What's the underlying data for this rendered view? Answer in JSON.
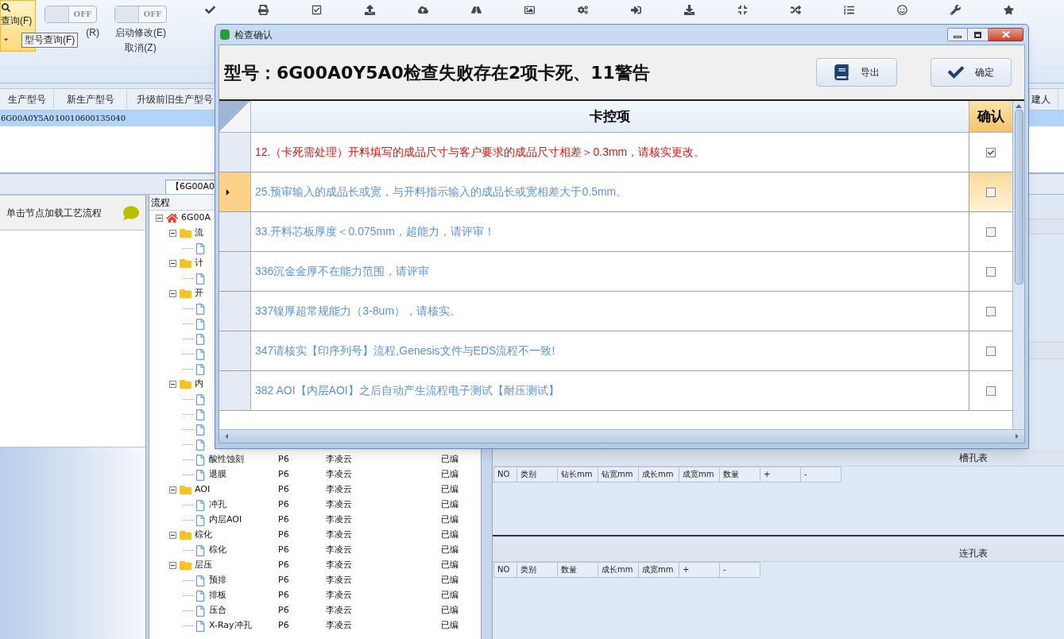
{
  "toolbar": {
    "query_button": {
      "label": "查询(F)"
    },
    "toggles": [
      {
        "label": "(R)",
        "state_text": "OFF",
        "on": false
      },
      {
        "label": "启动修改(E)",
        "sublabel": "取消(Z)",
        "state_text": "OFF",
        "on": false
      }
    ],
    "tooltip": "型号查询(F)"
  },
  "main_table": {
    "columns": [
      "生产型号",
      "新生产型号",
      "升级前旧生产型号",
      "建人"
    ],
    "rows": [
      {
        "cells": [
          "6G00A0Y5A0",
          "10010600135040"
        ],
        "selected": true
      }
    ]
  },
  "document_tab": {
    "label": "【6G00A0",
    "selected": true
  },
  "left_panel": {
    "title": "单击节点加载工艺流程"
  },
  "tree": {
    "header": "流程",
    "root": {
      "label": "6G00A",
      "kind": "home",
      "expanded": true,
      "children": [
        {
          "label": "流",
          "kind": "folder",
          "expanded": true,
          "children": [
            {
              "kind": "file"
            }
          ]
        },
        {
          "label": "计",
          "kind": "folder",
          "expanded": true,
          "children": [
            {
              "kind": "file"
            }
          ]
        },
        {
          "label": "开",
          "kind": "folder",
          "expanded": true,
          "children": [
            {
              "kind": "file"
            },
            {
              "kind": "file"
            },
            {
              "kind": "file"
            },
            {
              "kind": "file"
            },
            {
              "kind": "file"
            }
          ]
        },
        {
          "label": "内",
          "kind": "folder",
          "expanded": true,
          "children": [
            {
              "kind": "file"
            },
            {
              "kind": "file"
            },
            {
              "kind": "file"
            },
            {
              "kind": "file"
            },
            {
              "label": "酸性蚀刻",
              "kind": "file",
              "cells": [
                "P6",
                "李凌云",
                "已编"
              ]
            },
            {
              "label": "退膜",
              "kind": "file",
              "cells": [
                "P6",
                "李凌云",
                "已编"
              ]
            }
          ]
        },
        {
          "label": "AOI",
          "kind": "folder",
          "expanded": true,
          "cells": [
            "P6",
            "李凌云",
            "已编"
          ],
          "children": [
            {
              "label": "冲孔",
              "kind": "file",
              "cells": [
                "P6",
                "李凌云",
                "已编"
              ]
            },
            {
              "label": "内层AOI",
              "kind": "file",
              "cells": [
                "P6",
                "李凌云",
                "已编"
              ]
            }
          ]
        },
        {
          "label": "棕化",
          "kind": "folder",
          "expanded": true,
          "cells": [
            "P6",
            "李凌云",
            "已编"
          ],
          "children": [
            {
              "label": "棕化",
              "kind": "file",
              "cells": [
                "P6",
                "李凌云",
                "已编"
              ]
            }
          ]
        },
        {
          "label": "层压",
          "kind": "folder",
          "expanded": true,
          "cells": [
            "P6",
            "李凌云",
            "已编"
          ],
          "children": [
            {
              "label": "预排",
              "kind": "file",
              "cells": [
                "P6",
                "李凌云",
                "已编"
              ]
            },
            {
              "label": "排板",
              "kind": "file",
              "cells": [
                "P6",
                "李凌云",
                "已编"
              ]
            },
            {
              "label": "压合",
              "kind": "file",
              "cells": [
                "P6",
                "李凌云",
                "已编"
              ]
            },
            {
              "label": "X-Ray冲孔",
              "kind": "file",
              "cells": [
                "P6",
                "李凌云",
                "已编"
              ]
            }
          ]
        }
      ]
    }
  },
  "slot_table": {
    "title": "槽孔表",
    "columns": [
      "NO",
      "类别",
      "钻长mm",
      "钻宽mm",
      "成长mm",
      "成宽mm",
      "数量",
      "+",
      "-"
    ]
  },
  "link_table": {
    "title": "连孔表",
    "columns": [
      "NO",
      "类别",
      "数量",
      "成长mm",
      "成宽mm",
      "+",
      "-"
    ]
  },
  "dialog": {
    "title": "检查确认",
    "heading": "型号：6G00A0Y5A0检查失败存在2项卡死、11警告",
    "buttons": [
      {
        "label": "导出",
        "kind": "export"
      },
      {
        "label": "确定",
        "kind": "confirm"
      }
    ],
    "grid": {
      "columns": [
        "卡控项",
        "确认"
      ],
      "rows": [
        {
          "text": "12.（卡死需处理）开料填写的成品尺寸与客户要求的成品尺寸相差＞0.3mm，请核实更改。",
          "kind": "blocking",
          "checked": true,
          "selected": false
        },
        {
          "text": "25.预审输入的成品长或宽，与开料指示输入的成品长或宽相差大于0.5mm。",
          "kind": "warning",
          "checked": false,
          "selected": true
        },
        {
          "text": "33.开料芯板厚度＜0.075mm，超能力，请评审！",
          "kind": "warning",
          "checked": false,
          "selected": false
        },
        {
          "text": "336沉金金厚不在能力范围，请评审",
          "kind": "warning",
          "checked": false,
          "selected": false
        },
        {
          "text": "337镍厚超常规能力（3-8um），请核实。",
          "kind": "warning",
          "checked": false,
          "selected": false
        },
        {
          "text": "347请核实【印序列号】流程,Genesis文件与EDS流程不一致!",
          "kind": "warning",
          "checked": false,
          "selected": false
        },
        {
          "text": "382 AOI【内层AOI】之后自动产生流程电子测试【耐压测试】",
          "kind": "warning",
          "checked": false,
          "selected": false
        }
      ]
    }
  }
}
